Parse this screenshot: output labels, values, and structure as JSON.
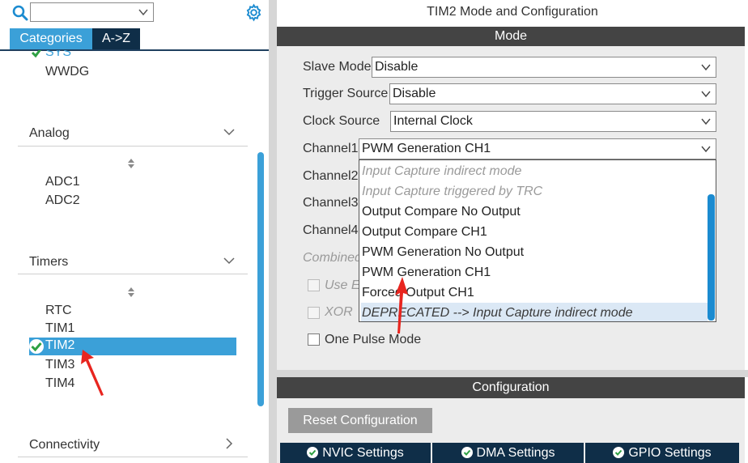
{
  "left": {
    "search": {
      "value": ""
    },
    "tabs": [
      {
        "label": "Categories",
        "active": true
      },
      {
        "label": "A->Z",
        "active": false
      }
    ],
    "system_items": [
      "SYS",
      "WWDG"
    ],
    "sections": {
      "analog": {
        "title": "Analog",
        "items": [
          "ADC1",
          "ADC2"
        ]
      },
      "timers": {
        "title": "Timers",
        "items": [
          "RTC",
          "TIM1",
          "TIM2",
          "TIM3",
          "TIM4"
        ],
        "selected": "TIM2"
      },
      "connectivity": {
        "title": "Connectivity"
      }
    }
  },
  "right": {
    "title": "TIM2 Mode and Configuration",
    "mode": {
      "header": "Mode",
      "fields": {
        "slave_mode": {
          "label": "Slave Mode",
          "value": "Disable"
        },
        "trigger_source": {
          "label": "Trigger Source",
          "value": "Disable"
        },
        "clock_source": {
          "label": "Clock Source",
          "value": "Internal Clock"
        },
        "channel1": {
          "label": "Channel1",
          "value": "PWM Generation CH1"
        },
        "channel2": {
          "label": "Channel2"
        },
        "channel3": {
          "label": "Channel3"
        },
        "channel4": {
          "label": "Channel4"
        },
        "combined": {
          "label": "Combined"
        },
        "use_e": {
          "label": "Use E"
        },
        "xor": {
          "label": "XOR"
        },
        "one_pulse": {
          "label": "One Pulse Mode"
        }
      },
      "dropdown_options": [
        {
          "label": "Input Capture indirect mode",
          "state": "disabled"
        },
        {
          "label": "Input Capture triggered by TRC",
          "state": "disabled"
        },
        {
          "label": "Output Compare No Output",
          "state": "normal"
        },
        {
          "label": "Output Compare CH1",
          "state": "normal"
        },
        {
          "label": "PWM Generation No Output",
          "state": "normal"
        },
        {
          "label": "PWM Generation CH1",
          "state": "normal"
        },
        {
          "label": "Forced Output CH1",
          "state": "normal"
        },
        {
          "label": "DEPRECATED --> Input Capture indirect mode",
          "state": "highlight"
        }
      ]
    },
    "configuration": {
      "header": "Configuration",
      "reset_label": "Reset Configuration",
      "tabs": [
        "NVIC Settings",
        "DMA Settings",
        "GPIO Settings"
      ]
    }
  },
  "colors": {
    "accent": "#3ba0d8",
    "dark_navy": "#0f2e48",
    "header_gray": "#444444",
    "check_green": "#2ea043",
    "annotation_red": "#e8251f"
  }
}
